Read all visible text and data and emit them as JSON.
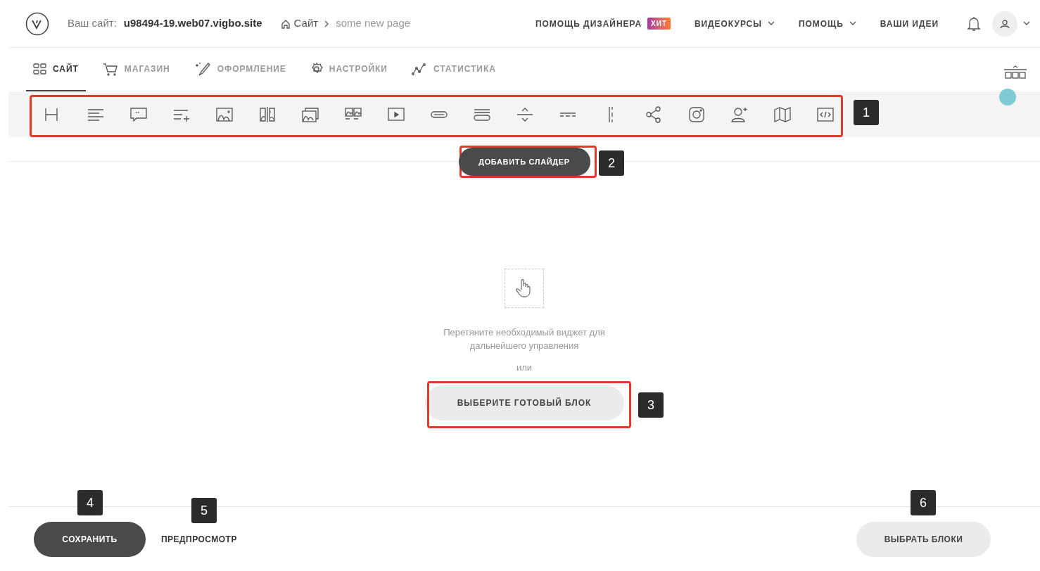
{
  "header": {
    "site_label": "Ваш сайт:",
    "site_domain": "u98494-19.web07.vigbo.site",
    "breadcrumb": [
      "Сайт",
      "some new page"
    ],
    "nav": [
      {
        "label": "ПОМОЩЬ ДИЗАЙНЕРА",
        "badge": "ХИТ",
        "dropdown": false
      },
      {
        "label": "ВИДЕОКУРСЫ",
        "dropdown": true
      },
      {
        "label": "ПОМОЩЬ",
        "dropdown": true
      },
      {
        "label": "ВАШИ ИДЕИ",
        "dropdown": false
      }
    ]
  },
  "tabs": [
    {
      "label": "САЙТ",
      "selected": true
    },
    {
      "label": "МАГАЗИН",
      "selected": false
    },
    {
      "label": "ОФОРМЛЕНИЕ",
      "selected": false
    },
    {
      "label": "НАСТРОЙКИ",
      "selected": false
    },
    {
      "label": "СТАТИСТИКА",
      "selected": false
    }
  ],
  "add_slider_button": "ДОБАВИТЬ СЛАЙДЕР",
  "drop_zone": {
    "hint": "Перетяните необходимый виджет для дальнейшего управления",
    "or": "или",
    "button": "ВЫБЕРИТЕ ГОТОВЫЙ БЛОК"
  },
  "footer": {
    "save_button": "СОХРАНИТЬ",
    "preview_link": "ПРЕДПРОСМОТР",
    "select_blocks_button": "ВЫБРАТЬ БЛОКИ"
  },
  "callouts": [
    {
      "label": "1"
    },
    {
      "label": "2"
    },
    {
      "label": "3"
    },
    {
      "label": "4"
    },
    {
      "label": "5"
    },
    {
      "label": "6"
    }
  ]
}
